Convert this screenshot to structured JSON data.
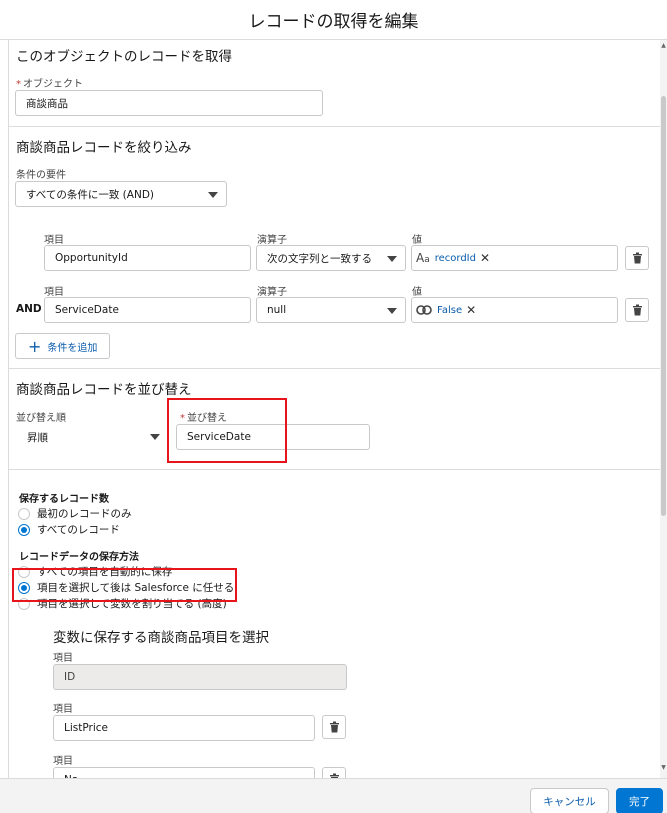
{
  "modal": {
    "title": "レコードの取得を編集"
  },
  "get_records": {
    "title": "このオブジェクトのレコードを取得",
    "object_label": "オブジェクト",
    "object_value": "商談商品"
  },
  "filter": {
    "title": "商談商品レコードを絞り込み",
    "condition_req_label": "条件の要件",
    "condition_req_value": "すべての条件に一致 (AND)",
    "rows": [
      {
        "field_label": "項目",
        "field_value": "OpportunityId",
        "op_label": "演算子",
        "op_value": "次の文字列と一致する",
        "value_label": "値",
        "value_pill": "recordId",
        "value_icon": "text-resource-icon",
        "connector": ""
      },
      {
        "field_label": "項目",
        "field_value": "ServiceDate",
        "op_label": "演算子",
        "op_value": "null",
        "value_label": "値",
        "value_pill": "False",
        "value_icon": "boolean-toggle-icon",
        "connector": "AND"
      }
    ],
    "add_condition": "条件を追加"
  },
  "sort": {
    "title": "商談商品レコードを並び替え",
    "order_label": "並び替え順",
    "order_value": "昇順",
    "by_label": "並び替え",
    "by_value": "ServiceDate"
  },
  "store": {
    "count_title": "保存するレコード数",
    "count_options": [
      {
        "label": "最初のレコードのみ",
        "selected": false
      },
      {
        "label": "すべてのレコード",
        "selected": true
      }
    ],
    "method_title": "レコードデータの保存方法",
    "method_options": [
      {
        "label": "すべての項目を自動的に保存",
        "selected": false
      },
      {
        "label": "項目を選択して後は Salesforce に任せる",
        "selected": true
      },
      {
        "label": "項目を選択して変数を割り当てる (高度)",
        "selected": false
      }
    ],
    "fields_title": "変数に保存する商談商品項目を選択",
    "fields": [
      {
        "label": "項目",
        "value": "ID",
        "disabled": true
      },
      {
        "label": "項目",
        "value": "ListPrice",
        "disabled": false
      },
      {
        "label": "項目",
        "value": "Na",
        "disabled": false
      }
    ]
  },
  "footer": {
    "cancel": "キャンセル",
    "done": "完了"
  },
  "colors": {
    "brand": "#0176d3",
    "highlight_box": "#e8141c",
    "required": "#c23934"
  }
}
